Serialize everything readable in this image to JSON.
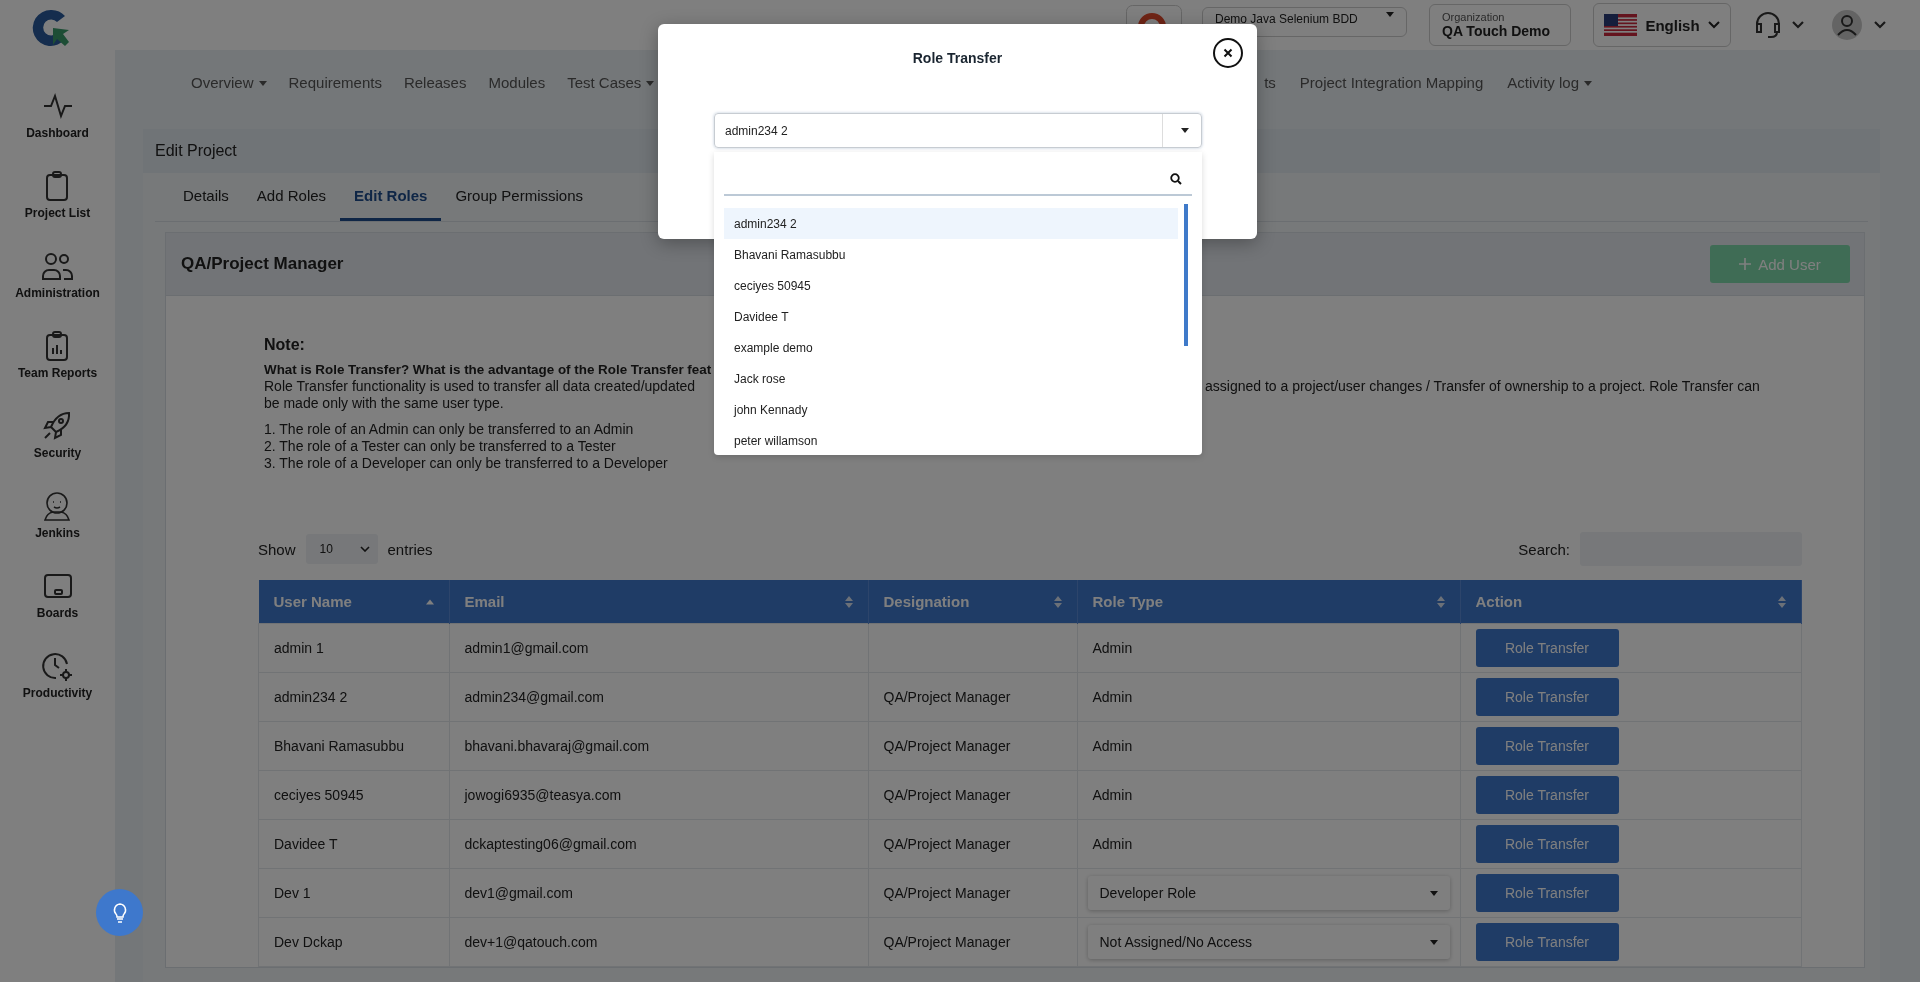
{
  "header": {
    "project_select": "Demo Java Selenium BDD",
    "organization_label": "Organization",
    "organization": "QA Touch Demo",
    "language": "English"
  },
  "sidebar": {
    "items": [
      {
        "label": "Dashboard"
      },
      {
        "label": "Project List"
      },
      {
        "label": "Administration"
      },
      {
        "label": "Team Reports"
      },
      {
        "label": "Security"
      },
      {
        "label": "Jenkins"
      },
      {
        "label": "Boards"
      },
      {
        "label": "Productivity"
      }
    ]
  },
  "nav": {
    "left": [
      {
        "label": "Overview",
        "dropdown": true
      },
      {
        "label": "Requirements",
        "dropdown": false
      },
      {
        "label": "Releases",
        "dropdown": false
      },
      {
        "label": "Modules",
        "dropdown": false
      },
      {
        "label": "Test Cases",
        "dropdown": true
      }
    ],
    "right": [
      {
        "label": "ts",
        "dropdown": false
      },
      {
        "label": "Project Integration Mapping",
        "dropdown": false
      },
      {
        "label": "Activity log",
        "dropdown": true
      }
    ]
  },
  "panel": {
    "title": "Edit Project",
    "tabs": [
      {
        "label": "Details",
        "selected": false
      },
      {
        "label": "Add Roles",
        "selected": false
      },
      {
        "label": "Edit Roles",
        "selected": true
      },
      {
        "label": "Group Permissions",
        "selected": false
      }
    ]
  },
  "card": {
    "title": "QA/Project Manager",
    "add_button": "Add User"
  },
  "note": {
    "heading": "Note:",
    "question": "What is Role Transfer? What is the advantage of the Role Transfer feat",
    "text_left": "Role Transfer functionality is used to transfer all data created/updated",
    "text_right": "assigned to a project/user changes / Transfer of ownership to a project. Role Transfer can",
    "text_cont": "be made only with the same user type.",
    "rules": [
      "1. The role of an Admin can only be transferred to an Admin",
      "2. The role of a Tester can only be transferred to a Tester",
      "3. The role of a Developer can only be transferred to a Developer"
    ]
  },
  "table_controls": {
    "show": "Show",
    "entries_value": "10",
    "entries": "entries",
    "search_label": "Search:"
  },
  "table": {
    "columns": [
      {
        "label": "User Name",
        "sorted": true
      },
      {
        "label": "Email",
        "sorted": false
      },
      {
        "label": "Designation",
        "sorted": false
      },
      {
        "label": "Role Type",
        "sorted": false
      },
      {
        "label": "Action",
        "sorted": false
      }
    ],
    "rows": [
      {
        "user": "admin 1",
        "email": "admin1@gmail.com",
        "role_type": {
          "kind": "text",
          "value": "Admin"
        },
        "action": "Role Transfer"
      },
      {
        "user": "admin234 2",
        "email": "admin234@gmail.com",
        "designation": "QA/Project Manager",
        "role_type": {
          "kind": "text",
          "value": "Admin"
        },
        "action": "Role Transfer"
      },
      {
        "user": "Bhavani Ramasubbu",
        "email": "bhavani.bhavaraj@gmail.com",
        "designation": "QA/Project Manager",
        "role_type": {
          "kind": "text",
          "value": "Admin"
        },
        "action": "Role Transfer"
      },
      {
        "user": "ceciyes 50945",
        "email": "jowogi6935@teasya.com",
        "designation": "QA/Project Manager",
        "role_type": {
          "kind": "text",
          "value": "Admin"
        },
        "action": "Role Transfer"
      },
      {
        "user": "Davidee T",
        "email": "dckaptesting06@gmail.com",
        "designation": "QA/Project Manager",
        "role_type": {
          "kind": "text",
          "value": "Admin"
        },
        "action": "Role Transfer"
      },
      {
        "user": "Dev 1",
        "email": "dev1@gmail.com",
        "designation": "QA/Project Manager",
        "role_type": {
          "kind": "select",
          "value": "Developer Role"
        },
        "action": "Role Transfer"
      },
      {
        "user": "Dev Dckap",
        "email": "dev+1@qatouch.com",
        "designation": "QA/Project Manager",
        "role_type": {
          "kind": "select",
          "value": "Not Assigned/No Access"
        },
        "action": "Role Transfer"
      }
    ]
  },
  "modal": {
    "title": "Role Transfer",
    "select_value": "admin234 2",
    "options": [
      {
        "label": "admin234 2",
        "selected": true
      },
      {
        "label": "Bhavani Ramasubbu",
        "selected": false
      },
      {
        "label": "ceciyes 50945",
        "selected": false
      },
      {
        "label": "Davidee T",
        "selected": false
      },
      {
        "label": "example demo",
        "selected": false
      },
      {
        "label": "Jack rose",
        "selected": false
      },
      {
        "label": "john Kennady",
        "selected": false
      },
      {
        "label": "peter willamson",
        "selected": false
      }
    ]
  }
}
